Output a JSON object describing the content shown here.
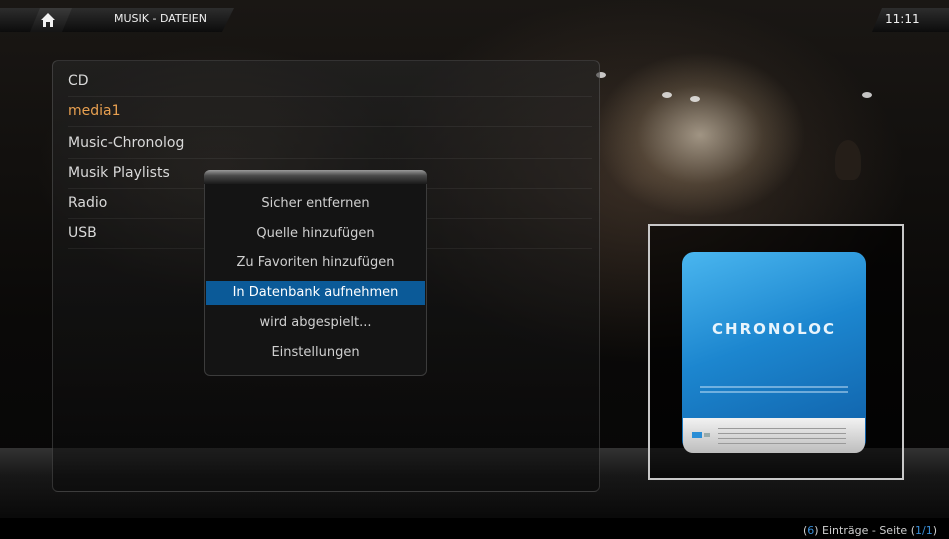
{
  "header": {
    "title": "MUSIK - DATEIEN",
    "clock": "11:11"
  },
  "list": {
    "items": [
      {
        "label": "CD"
      },
      {
        "label": "media1",
        "selected": true
      },
      {
        "label": "Music-Chronolog"
      },
      {
        "label": "Musik Playlists"
      },
      {
        "label": "Radio"
      },
      {
        "label": "USB"
      }
    ]
  },
  "context_menu": {
    "items": [
      {
        "label": "Sicher entfernen"
      },
      {
        "label": "Quelle hinzufügen"
      },
      {
        "label": "Zu Favoriten hinzufügen"
      },
      {
        "label": "In Datenbank aufnehmen",
        "focused": true
      },
      {
        "label": "wird abgespielt..."
      },
      {
        "label": "Einstellungen"
      }
    ]
  },
  "thumbnail": {
    "brand": "CHRONOLOC",
    "icon": "hard-drive-icon",
    "color": "#1c86cf"
  },
  "footer": {
    "count": "6",
    "entries_label": "Einträge - Seite",
    "page": "1/1"
  },
  "colors": {
    "selected_text": "#e8a050",
    "focus": "#0b5a98",
    "highlight": "#3a8fd8"
  }
}
